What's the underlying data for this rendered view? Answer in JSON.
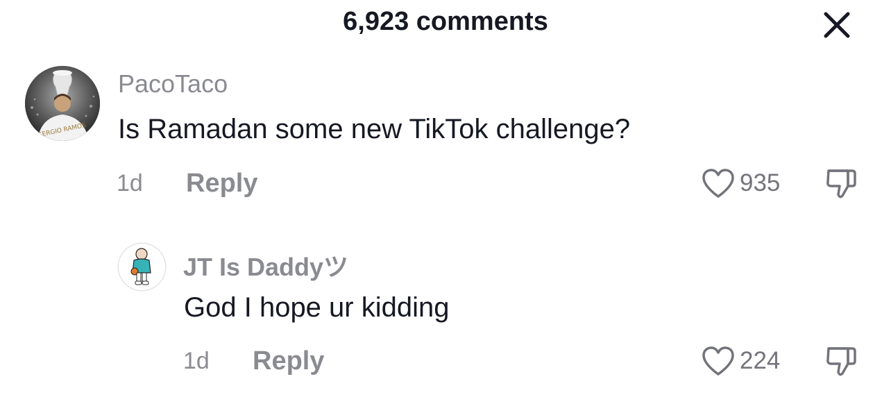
{
  "header": {
    "title": "6,923 comments",
    "close_icon": "close-icon"
  },
  "comments": [
    {
      "username": "PacoTaco",
      "text": "Is Ramadan some new TikTok challenge?",
      "time": "1d",
      "reply_label": "Reply",
      "likes": "935",
      "avatar_text": "SERGIO RAMOS"
    },
    {
      "username": "JT Is Daddyツ",
      "text": "God I hope ur kidding",
      "time": "1d",
      "reply_label": "Reply",
      "likes": "224"
    }
  ],
  "colors": {
    "primary_text": "#161823",
    "secondary_text": "#8a8b91",
    "icon": "#73747b",
    "background": "#ffffff"
  }
}
